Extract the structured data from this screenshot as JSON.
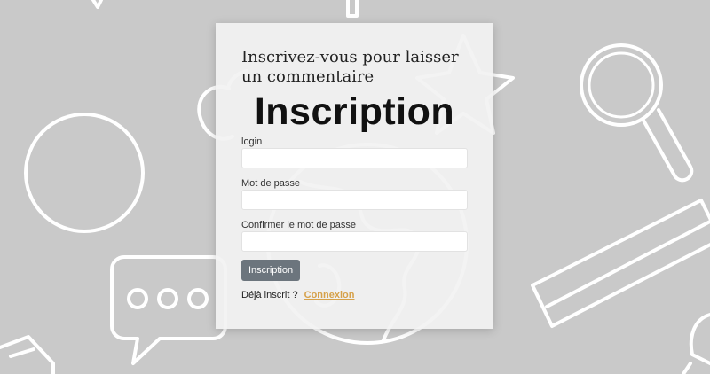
{
  "form": {
    "subtitle": "Inscrivez-vous pour laisser un commentaire",
    "title": "Inscription",
    "fields": [
      {
        "label": "login",
        "value": "",
        "placeholder": ""
      },
      {
        "label": "Mot de passe",
        "value": "",
        "placeholder": ""
      },
      {
        "label": "Confirmer le mot de passe",
        "value": "",
        "placeholder": ""
      }
    ],
    "submit_label": "Inscription",
    "already_registered_text": "Déjà inscrit ?",
    "login_link_label": "Connexion"
  },
  "colors": {
    "background": "#c9c9c9",
    "card": "#f2f2f2",
    "button": "#6c757d",
    "link": "#d6a14a"
  },
  "background_icons": [
    "circle-outline-icon",
    "magnifier-icon",
    "star-icon",
    "globe-icon",
    "apple-icon",
    "speech-bubble-icon",
    "ruler-icon",
    "book-icon"
  ]
}
